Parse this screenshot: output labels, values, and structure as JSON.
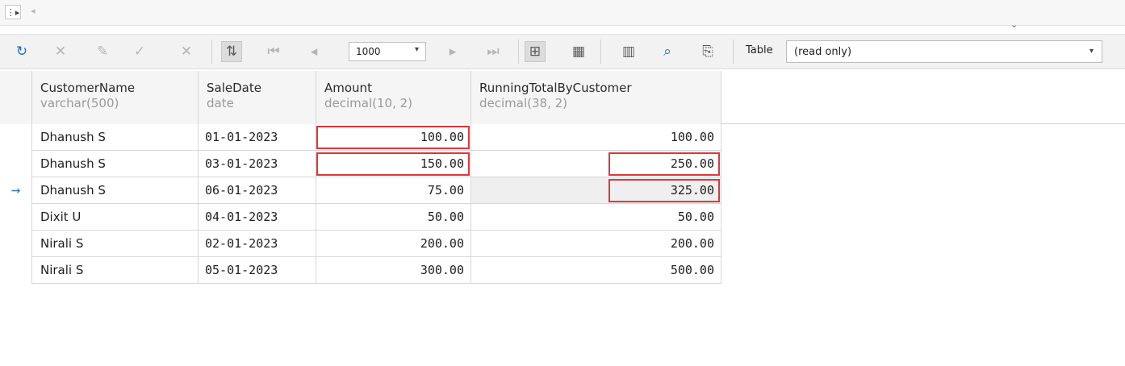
{
  "topstrip": {
    "split_icon": "split-view-icon",
    "scroll_left": "scroll-left-icon",
    "collapse": "chevron-down-icon"
  },
  "toolbar": {
    "page_size": "1000",
    "table_label": "Table",
    "table_value": "(read only)"
  },
  "grid": {
    "columns": [
      {
        "name": "CustomerName",
        "type": "varchar(500)"
      },
      {
        "name": "SaleDate",
        "type": "date"
      },
      {
        "name": "Amount",
        "type": "decimal(10, 2)"
      },
      {
        "name": "RunningTotalByCustomer",
        "type": "decimal(38, 2)"
      }
    ],
    "rows": [
      {
        "customer": "Dhanush S",
        "date": "01-01-2023",
        "amount": "100.00",
        "running": "100.00"
      },
      {
        "customer": "Dhanush S",
        "date": "03-01-2023",
        "amount": "150.00",
        "running": "250.00"
      },
      {
        "customer": "Dhanush S",
        "date": "06-01-2023",
        "amount": "75.00",
        "running": "325.00"
      },
      {
        "customer": "Dixit U",
        "date": "04-01-2023",
        "amount": "50.00",
        "running": "50.00"
      },
      {
        "customer": "Nirali S",
        "date": "02-01-2023",
        "amount": "200.00",
        "running": "200.00"
      },
      {
        "customer": "Nirali S",
        "date": "05-01-2023",
        "amount": "300.00",
        "running": "500.00"
      }
    ],
    "current_row_indicator": "→",
    "highlight_color": "#e0353c"
  }
}
